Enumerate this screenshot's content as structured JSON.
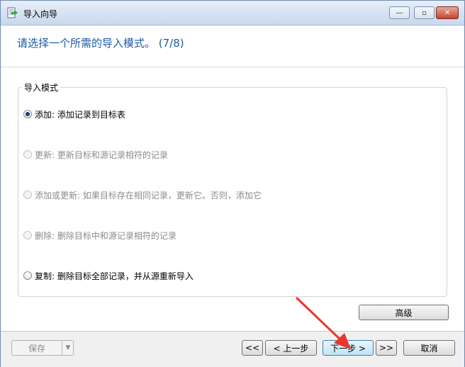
{
  "window": {
    "title": "导入向导"
  },
  "titlebar_buttons": {
    "minimize": "—",
    "maximize": "▫",
    "close": "✕"
  },
  "header": {
    "text": "请选择一个所需的导入模式。 (7/8)"
  },
  "import_mode": {
    "legend": "导入模式",
    "options": [
      {
        "label": "添加: 添加记录到目标表",
        "checked": true,
        "disabled": false
      },
      {
        "label": "更新: 更新目标和源记录相符的记录",
        "checked": false,
        "disabled": true
      },
      {
        "label": "添加或更新: 如果目标存在相同记录，更新它。否则，添加它",
        "checked": false,
        "disabled": true
      },
      {
        "label": "删除: 删除目标中和源记录相符的记录",
        "checked": false,
        "disabled": true
      },
      {
        "label": "复制: 删除目标全部记录，并从源重新导入",
        "checked": false,
        "disabled": false
      }
    ]
  },
  "buttons": {
    "advanced": "高级",
    "save": "保存",
    "save_arrow": "▼",
    "first": "<<",
    "prev": "< 上一步",
    "next": "下一步 >",
    "last": ">>",
    "cancel": "取消"
  },
  "colors": {
    "header_text": "#1c5aa6",
    "annotation_arrow": "#e8382e"
  }
}
